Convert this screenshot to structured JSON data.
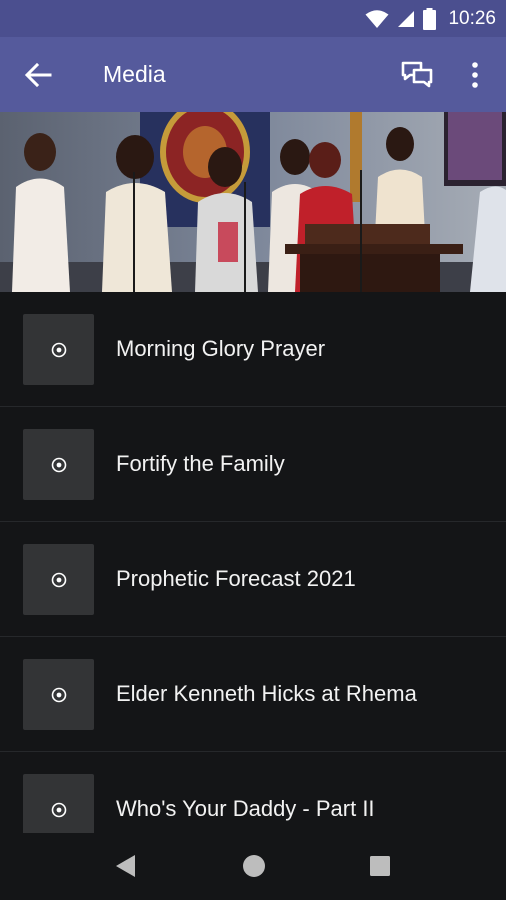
{
  "status_bar": {
    "time": "10:26",
    "icons": [
      "wifi-icon",
      "cell-signal-icon",
      "battery-icon"
    ]
  },
  "app_bar": {
    "title": "Media",
    "back_icon": "arrow-left-icon",
    "actions": [
      "chat-icon",
      "more-vert-icon"
    ]
  },
  "hero": {
    "description_icon": "choir-photo"
  },
  "media_items": [
    {
      "title": "Morning Glory Prayer",
      "icon": "play-circle-icon"
    },
    {
      "title": "Fortify the Family",
      "icon": "play-circle-icon"
    },
    {
      "title": "Prophetic Forecast 2021",
      "icon": "play-circle-icon"
    },
    {
      "title": "Elder Kenneth Hicks at Rhema",
      "icon": "play-circle-icon"
    },
    {
      "title": "Who's Your Daddy - Part II",
      "icon": "play-circle-icon"
    }
  ],
  "nav_bar": {
    "buttons": [
      "back-triangle-icon",
      "home-circle-icon",
      "recents-square-icon"
    ]
  },
  "colors": {
    "status_bar": "#4b4f8f",
    "app_bar": "#555a9c",
    "background": "#141517",
    "thumbnail": "#333436",
    "divider": "#26282b",
    "text": "#f2f2f2"
  }
}
